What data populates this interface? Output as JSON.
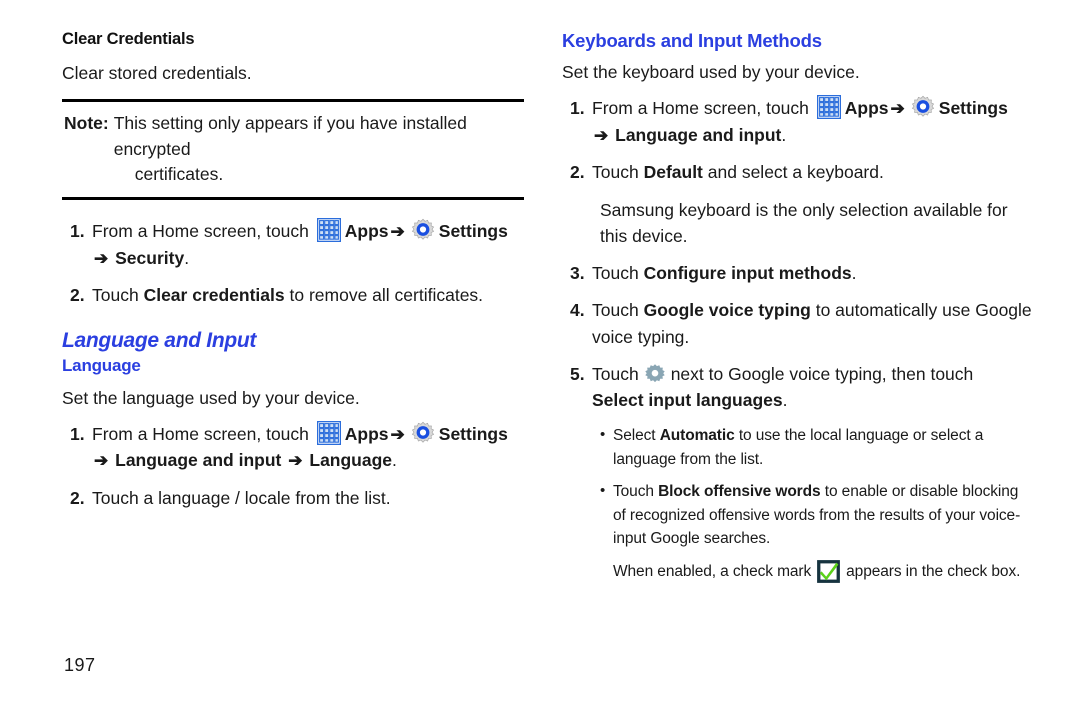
{
  "page": {
    "number": "197"
  },
  "icons": {
    "apps": "apps-grid-icon",
    "settings": "settings-gear-icon",
    "gear_small": "gear-icon",
    "checkbox": "checkbox-checked-icon",
    "arrow": "➔",
    "bullet": "•"
  },
  "colors": {
    "heading_blue": "#2b3fe0",
    "body_black": "#1a1a1a",
    "apps_icon_blue": "#2b6ddb",
    "settings_ring_blue": "#1a4fe0",
    "gear_gray": "#8aa6b4",
    "checkbox_border": "#16333f",
    "check_green": "#5bd11a"
  },
  "left_column": {
    "heading": "Clear Credentials",
    "intro": "Clear stored credentials.",
    "note": {
      "label": "Note:",
      "text": "This setting only appears if you have installed encrypted",
      "continuation": "certificates."
    },
    "steps": [
      {
        "number": "1.",
        "prefix": "From a Home screen, touch",
        "apps_label": "Apps",
        "settings_label": "Settings",
        "arrow": "➔",
        "target": "Security",
        "period": "."
      },
      {
        "number": "2.",
        "prefix": "Touch",
        "bold": "Clear credentials",
        "suffix": "to remove all certificates."
      }
    ],
    "section_heading": "Language and Input",
    "sub_heading": "Language",
    "sub_intro": "Set the language used by your device.",
    "sub_steps": [
      {
        "number": "1.",
        "prefix": "From a Home screen, touch",
        "apps_label": "Apps",
        "settings_label": "Settings",
        "arrow": "➔",
        "target_1": "Language and input",
        "target_2": "Language",
        "period": "."
      },
      {
        "number": "2.",
        "text": "Touch a language / locale from the list."
      }
    ]
  },
  "right_column": {
    "heading": "Keyboards and Input Methods",
    "intro": "Set the keyboard used by your device.",
    "steps": [
      {
        "number": "1.",
        "prefix": "From a Home screen, touch",
        "apps_label": "Apps",
        "settings_label": "Settings",
        "arrow": "➔",
        "target": "Language and input",
        "period": "."
      },
      {
        "number": "2.",
        "prefix": "Touch",
        "bold": "Default",
        "suffix": "and select a keyboard."
      },
      {
        "number": "3.",
        "prefix": "Touch",
        "bold": "Configure input methods",
        "suffix": "."
      },
      {
        "number": "4.",
        "prefix": "Touch",
        "bold": "Google voice typing",
        "suffix": "to automatically use Google voice typing."
      },
      {
        "number": "5.",
        "prefix": "Touch",
        "middle": "next to Google voice typing, then touch",
        "bold": "Select input languages",
        "suffix": "."
      }
    ],
    "note_after_step2": "Samsung keyboard is the only selection available for this device.",
    "sub_bullets": [
      {
        "prefix": "Select",
        "bold": "Automatic",
        "suffix": "to use the local language or select a language from the list."
      },
      {
        "prefix": "Touch",
        "bold": "Block offensive words",
        "suffix": "to enable or disable blocking of recognized offensive words from the results of your voice-input Google searches."
      }
    ],
    "checkbox_note": {
      "prefix": "When enabled, a check mark",
      "suffix": "appears in the check box."
    }
  }
}
